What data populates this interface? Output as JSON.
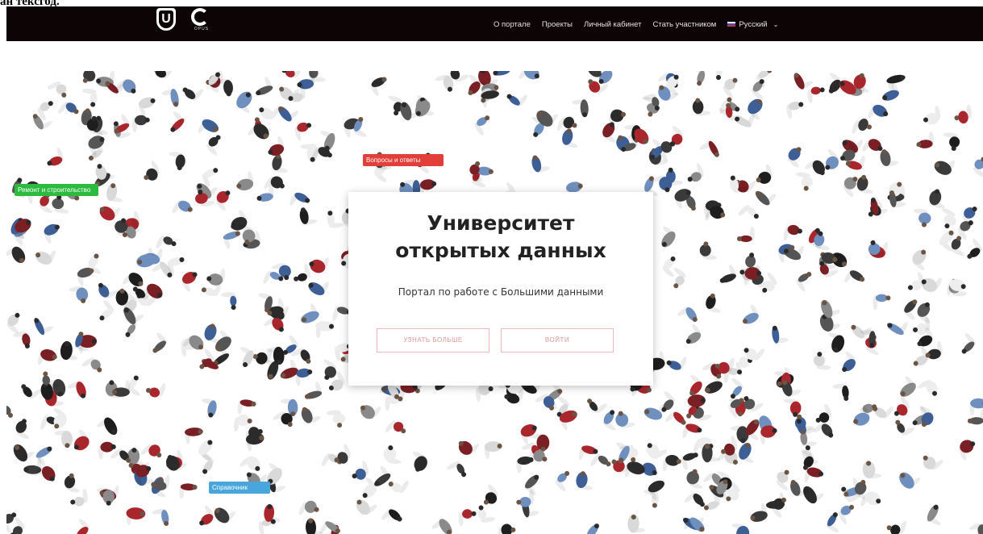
{
  "page_fragment": "ан тексгод.",
  "header": {
    "logo_u_letter": "U",
    "logo_opus_caption": "OPUS",
    "nav": {
      "about": "О портале",
      "projects": "Проекты",
      "cabinet": "Личный кабинет",
      "join": "Стать участником",
      "language": "Русский"
    },
    "colors": {
      "background": "#0c0405",
      "nav_text": "#e6e2e2"
    }
  },
  "tags": {
    "green": "Ремонт и строительство",
    "red": "Вопросы и ответы",
    "blue": "Справочник"
  },
  "hero": {
    "title_line1": "Университет",
    "title_line2": "открытых данных",
    "subtitle": "Портал по работе с Большими данными",
    "more_button": "УЗНАТЬ БОЛЬШЕ",
    "login_button": "ВОЙТИ",
    "accent_color": "#e8b9b6"
  }
}
